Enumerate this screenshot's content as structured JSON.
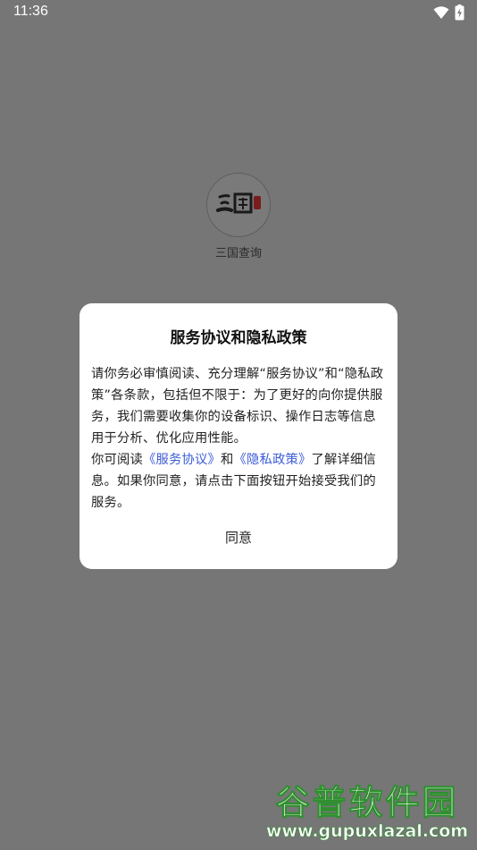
{
  "status_bar": {
    "time": "11:36"
  },
  "app": {
    "name": "三国查询"
  },
  "dialog": {
    "title": "服务协议和隐私政策",
    "paragraph1": "请你务必审慎阅读、充分理解“服务协议”和“隐私政策”各条款，包括但不限于：为了更好的向你提供服务，我们需要收集你的设备标识、操作日志等信息用于分析、优化应用性能。",
    "p2_prefix": "你可阅读",
    "link_service": "《服务协议》",
    "p2_and": "和",
    "link_privacy": "《隐私政策》",
    "p2_suffix": "了解详细信息。如果你同意，请点击下面按钮开始接受我们的服务。",
    "agree_label": "同意"
  },
  "watermark": {
    "title": "谷普软件园",
    "url": "www.gupuxlazal.com"
  },
  "colors": {
    "link": "#3b5bd6",
    "dim_overlay": "#767676"
  }
}
